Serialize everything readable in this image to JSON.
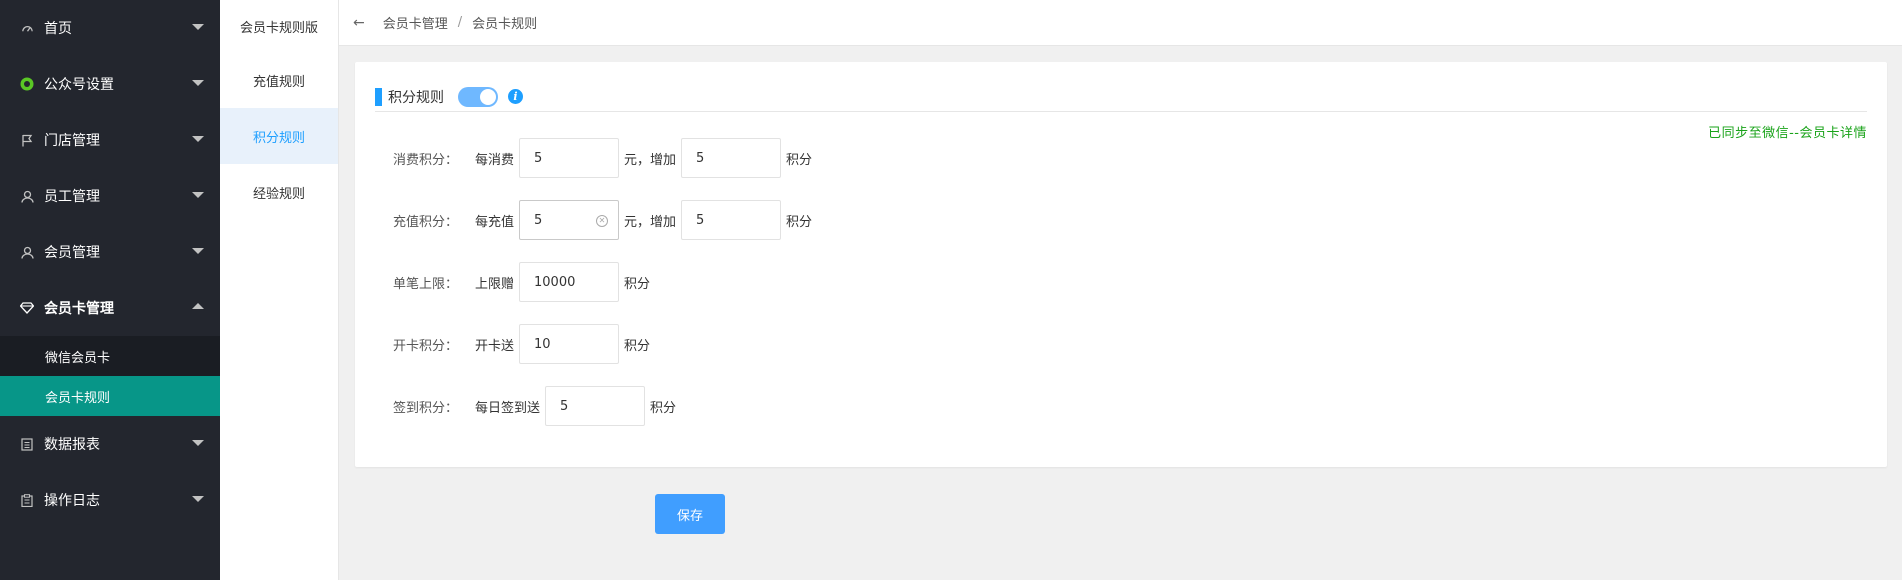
{
  "sidebar": {
    "items": [
      {
        "label": "首页",
        "icon": "dashboard-icon"
      },
      {
        "label": "公众号设置",
        "icon": "wechat-icon"
      },
      {
        "label": "门店管理",
        "icon": "flag-icon"
      },
      {
        "label": "员工管理",
        "icon": "user-icon"
      },
      {
        "label": "会员管理",
        "icon": "user-icon"
      },
      {
        "label": "会员卡管理",
        "icon": "diamond-icon"
      },
      {
        "label": "数据报表",
        "icon": "report-icon"
      },
      {
        "label": "操作日志",
        "icon": "log-icon"
      }
    ],
    "subitems": [
      {
        "label": "微信会员卡"
      },
      {
        "label": "会员卡规则"
      }
    ],
    "active_color": "#079688"
  },
  "subnav": {
    "title": "会员卡规则版",
    "items": [
      {
        "label": "充值规则"
      },
      {
        "label": "积分规则"
      },
      {
        "label": "经验规则"
      }
    ]
  },
  "breadcrumb": {
    "back_icon": "arrow-left-icon",
    "parent": "会员卡管理",
    "separator": "/",
    "current": "会员卡规则"
  },
  "card": {
    "title": "积分规则",
    "switch_on": true,
    "info_glyph": "i",
    "sync_text": "已同步至微信--会员卡详情",
    "sync_color": "#1aa31a",
    "rows": [
      {
        "label": "消费积分：",
        "prefix": "每消费",
        "value": "5",
        "mid": "元，增加",
        "value2": "5",
        "suffix": "积分"
      },
      {
        "label": "充值积分：",
        "prefix": "每充值",
        "value": "5",
        "mid": "元，增加",
        "value2": "5",
        "suffix": "积分"
      },
      {
        "label": "单笔上限：",
        "prefix": "上限赠",
        "value": "10000",
        "suffix": "积分"
      },
      {
        "label": "开卡积分：",
        "prefix": "开卡送",
        "value": "10",
        "suffix": "积分"
      },
      {
        "label": "签到积分：",
        "prefix": "每日签到送",
        "value": "5",
        "suffix": "积分"
      }
    ]
  },
  "save_label": "保存",
  "accent": "#1e9fff"
}
